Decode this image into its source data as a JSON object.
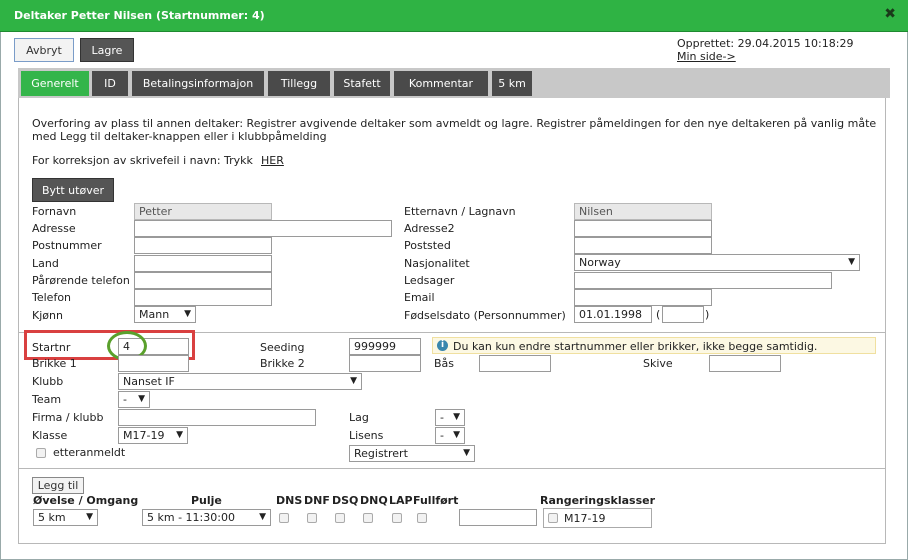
{
  "window": {
    "title": "Deltaker Petter Nilsen (Startnummer: 4)",
    "close_glyph": "✖",
    "accent_color": "#2fb344"
  },
  "toolbar": {
    "cancel_label": "Avbryt",
    "save_label": "Lagre",
    "created_text": "Opprettet: 29.04.2015 10:18:29",
    "my_page_link": "Min side->"
  },
  "tabs": [
    "Generelt",
    "ID",
    "Betalingsinformajon",
    "Tillegg",
    "Stafett",
    "Kommentar",
    "5 km"
  ],
  "transfer": {
    "info_line1": "Overforing av plass til annen deltaker: Registrer avgivende deltaker som avmeldt og lagre. Registrer påmeldingen for den nye deltakeren på vanlig måte",
    "info_line2": "med Legg til deltaker-knappen eller i klubbpåmelding",
    "correction_text": "For korreksjon av skrivefeil i navn: Trykk",
    "correction_link": "HER",
    "change_athlete_button": "Bytt utøver"
  },
  "person": {
    "first_name_label": "Fornavn",
    "first_name_value": "Petter",
    "address_label": "Adresse",
    "address_value": "",
    "postal_code_label": "Postnummer",
    "postal_code_value": "",
    "country_label": "Land",
    "country_value": "",
    "relative_phone_label": "Pårørende telefon",
    "relative_phone_value": "",
    "phone_label": "Telefon",
    "phone_value": "",
    "gender_label": "Kjønn",
    "gender_value": "Mann",
    "last_name_label": "Etternavn / Lagnavn",
    "last_name_value": "Nilsen",
    "address2_label": "Adresse2",
    "address2_value": "",
    "city_label": "Poststed",
    "city_value": "",
    "nationality_label": "Nasjonalitet",
    "nationality_value": "Norway",
    "companion_label": "Ledsager",
    "companion_value": "",
    "email_label": "Email",
    "email_value": "",
    "birthdate_label": "Fødselsdato (Personnummer)",
    "birthdate_value": "01.01.1998",
    "personnummer_value": "",
    "paren_open": "(",
    "paren_close": ")"
  },
  "race": {
    "start_number_label": "Startnr",
    "start_number_value": "4",
    "seeding_label": "Seeding",
    "seeding_value": "999999",
    "notice_text": "Du kan kun endre startnummer eller brikker, ikke begge samtidig.",
    "chip1_label": "Brikke 1",
    "chip1_value": "",
    "chip2_label": "Brikke 2",
    "chip2_value": "",
    "lane_label": "Bås",
    "lane_value": "",
    "disc_label": "Skive",
    "disc_value": "",
    "club_label": "Klubb",
    "club_value": "Nanset IF",
    "team_label": "Team",
    "team_value": "-",
    "company_label": "Firma / klubb",
    "company_value": "",
    "class_label": "Klasse",
    "class_value": "M17-19",
    "late_label": "etteranmeldt",
    "lag_label": "Lag",
    "lag_value": "-",
    "license_label": "Lisens",
    "license_value": "-",
    "status_value": "Registrert"
  },
  "events": {
    "add_button": "Legg til",
    "col_event": "Øvelse / Omgang",
    "col_heat": "Pulje",
    "col_dns": "DNS",
    "col_dnf": "DNF",
    "col_dsq": "DSQ",
    "col_dnq": "DNQ",
    "col_lap": "LAP",
    "col_completed": "Fullført",
    "col_ranking": "Rangeringsklasser",
    "row_event": "5 km",
    "row_heat": "5 km - 11:30:00",
    "row_result": "",
    "row_ranking_class": "M17-19"
  },
  "highlight": {
    "box_color": "#d94040",
    "circle_color": "#5aa02c"
  }
}
